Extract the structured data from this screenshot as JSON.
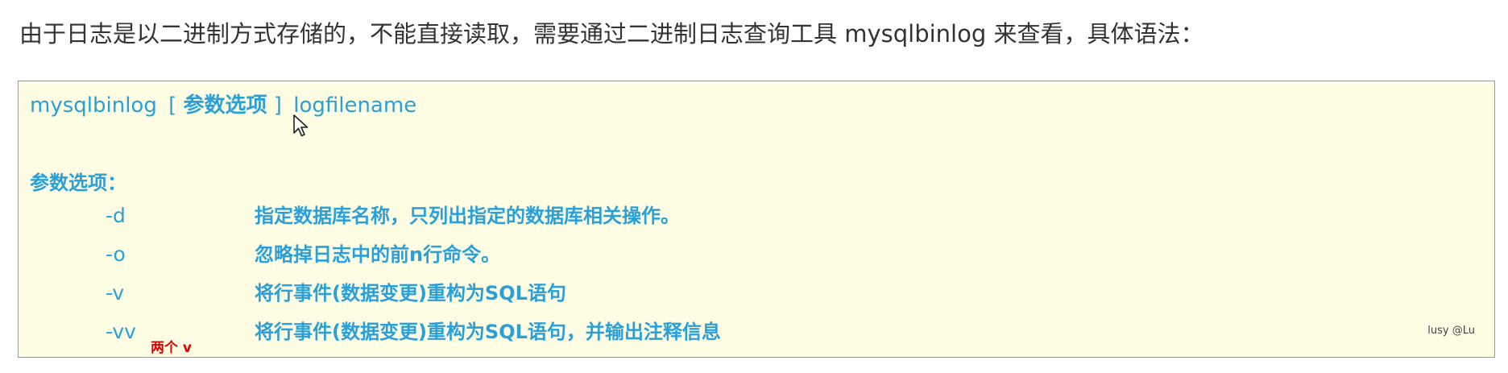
{
  "intro": {
    "text": "由于日志是以二进制方式存储的，不能直接读取，需要通过二进制日志查询工具 mysqlbinlog 来查看，具体语法："
  },
  "syntax": {
    "command": "mysqlbinlog",
    "bracket_open": "[",
    "options_label": "参数选项",
    "bracket_close": "]",
    "filename": "logfilename"
  },
  "options": {
    "title": "参数选项：",
    "items": [
      {
        "flag": "-d",
        "description": "指定数据库名称，只列出指定的数据库相关操作。"
      },
      {
        "flag": "-o",
        "description": "忽略掉日志中的前n行命令。"
      },
      {
        "flag": "-v",
        "description": "将行事件(数据变更)重构为SQL语句"
      },
      {
        "flag": "-vv",
        "description": "将行事件(数据变更)重构为SQL语句，并输出注释信息"
      }
    ]
  },
  "annotation": {
    "text": "两个 v",
    "color": "#dd0000"
  },
  "watermark": {
    "text": "lusy @Lu"
  },
  "colors": {
    "accent": "#2a9fd8",
    "box_background": "#fefde4",
    "body_text": "#333333"
  },
  "icons": {
    "cursor": "mouse-pointer-icon"
  }
}
